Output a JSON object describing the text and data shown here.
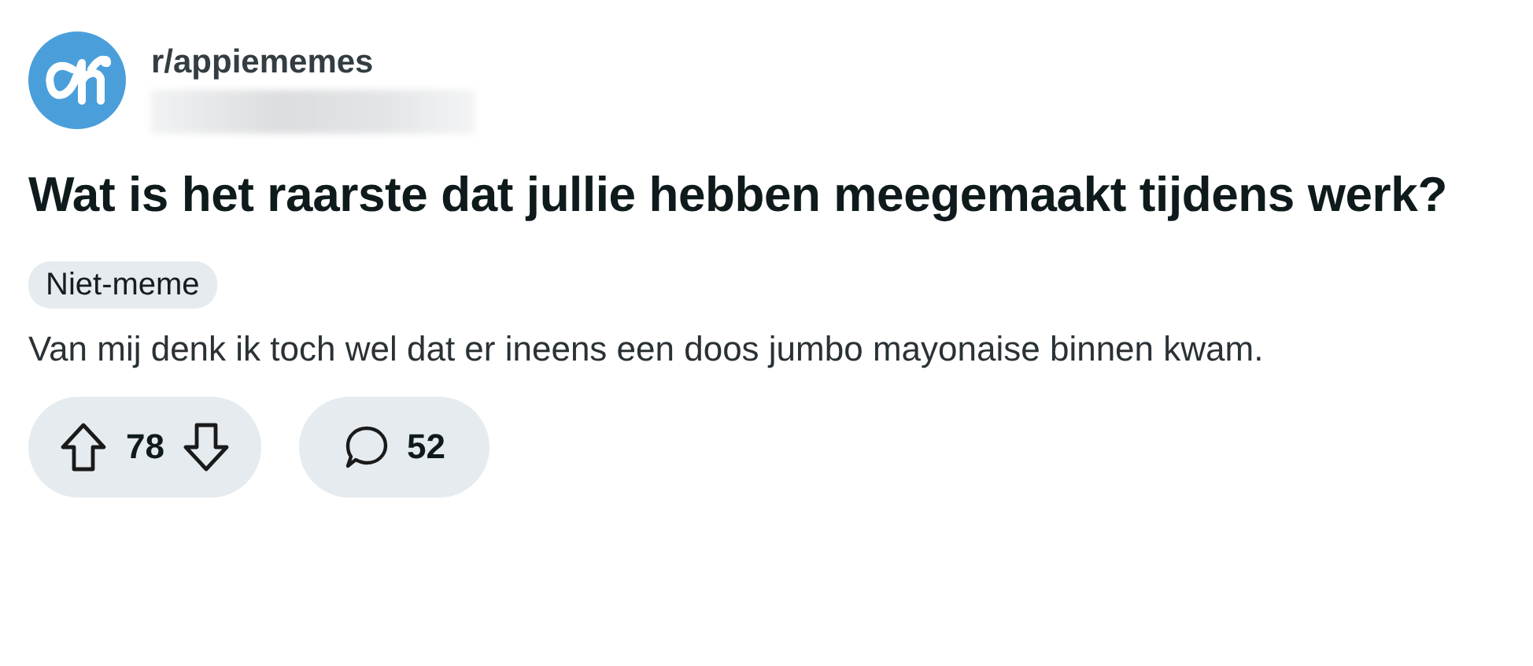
{
  "post": {
    "community": "r/appiememes",
    "title": "Wat is het raarste dat jullie hebben meegemaakt tijdens werk?",
    "flair": "Niet-meme",
    "body": "Van mij denk ik toch wel dat er ineens een doos jumbo mayonaise binnen kwam.",
    "votes": "78",
    "comments": "52"
  }
}
